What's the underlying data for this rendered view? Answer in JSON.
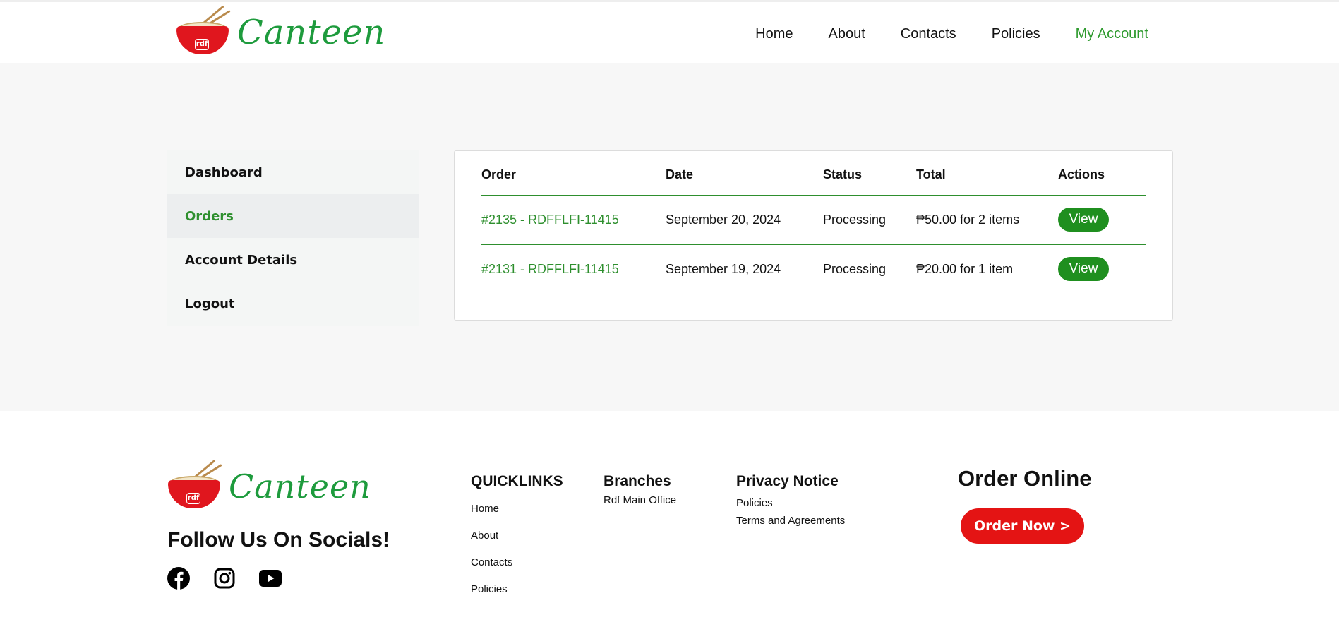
{
  "brand": {
    "name": "Canteen",
    "badge": "rdf"
  },
  "nav": {
    "items": [
      {
        "label": "Home"
      },
      {
        "label": "About"
      },
      {
        "label": "Contacts"
      },
      {
        "label": "Policies"
      },
      {
        "label": "My Account",
        "active": true
      }
    ]
  },
  "sidebar": {
    "items": [
      {
        "label": "Dashboard"
      },
      {
        "label": "Orders",
        "active": true
      },
      {
        "label": "Account Details"
      },
      {
        "label": "Logout"
      }
    ]
  },
  "orders": {
    "columns": [
      "Order",
      "Date",
      "Status",
      "Total",
      "Actions"
    ],
    "rows": [
      {
        "order": "#2135 - RDFFLFI-11415",
        "date": "September 20, 2024",
        "status": "Processing",
        "total": "₱50.00 for 2 items",
        "action": "View"
      },
      {
        "order": "#2131 - RDFFLFI-11415",
        "date": "September 19, 2024",
        "status": "Processing",
        "total": "₱20.00 for 1 item",
        "action": "View"
      }
    ]
  },
  "footer": {
    "follow_title": "Follow Us On Socials!",
    "socials": [
      "facebook-icon",
      "instagram-icon",
      "youtube-icon"
    ],
    "quicklinks": {
      "title": "QUICKLINKS",
      "links": [
        "Home",
        "About",
        "Contacts",
        "Policies"
      ]
    },
    "branches": {
      "title": "Branches",
      "links": [
        "Rdf Main Office"
      ]
    },
    "privacy": {
      "title": "Privacy Notice",
      "links": [
        "Policies",
        "Terms and Agreements"
      ]
    },
    "order_online": {
      "title": "Order Online",
      "button": "Order Now >"
    }
  },
  "colors": {
    "accent_green": "#2e8f2e",
    "button_green": "#1f8f1f",
    "brand_red": "#e41414"
  }
}
